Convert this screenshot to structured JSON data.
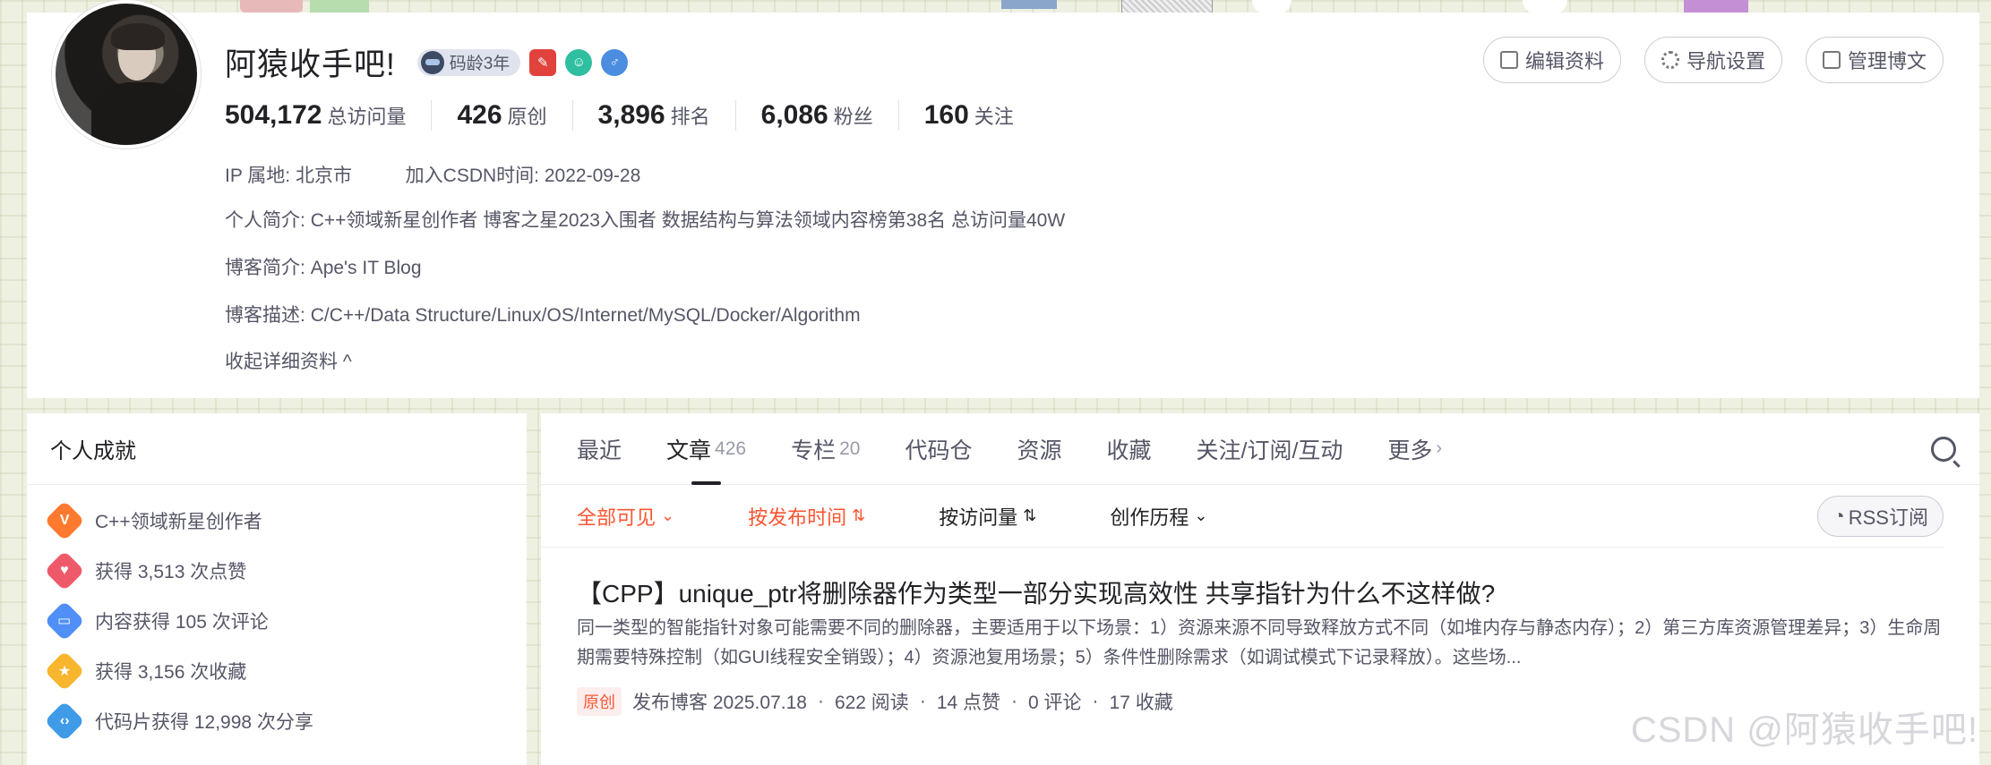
{
  "profile": {
    "username": "阿猿收手吧!",
    "years_badge": "码龄3年",
    "actions": {
      "edit": "编辑资料",
      "nav": "导航设置",
      "manage": "管理博文"
    },
    "stats": [
      {
        "num": "504,172",
        "label": "总访问量"
      },
      {
        "num": "426",
        "label": "原创"
      },
      {
        "num": "3,896",
        "label": "排名"
      },
      {
        "num": "6,086",
        "label": "粉丝"
      },
      {
        "num": "160",
        "label": "关注"
      }
    ],
    "ip_label": "IP 属地:",
    "ip_value": "北京市",
    "join_label": "加入CSDN时间:",
    "join_value": "2022-09-28",
    "intro_label": "个人简介:",
    "intro_value": "C++领域新星创作者 博客之星2023入围者 数据结构与算法领域内容榜第38名 总访问量40W",
    "blog_label": "博客简介:",
    "blog_value": "Ape's IT Blog",
    "desc_label": "博客描述:",
    "desc_value": "C/C++/Data Structure/Linux/OS/Internet/MySQL/Docker/Algorithm",
    "collapse": "收起详细资料"
  },
  "sidebar": {
    "title": "个人成就",
    "items": [
      {
        "text": "C++领域新星创作者",
        "icon": "V"
      },
      {
        "text": "获得 3,513 次点赞"
      },
      {
        "text": "内容获得 105 次评论"
      },
      {
        "text": "获得 3,156 次收藏"
      },
      {
        "text": "代码片获得 12,998 次分享"
      }
    ]
  },
  "tabs": [
    {
      "label": "最近"
    },
    {
      "label": "文章",
      "count": "426"
    },
    {
      "label": "专栏",
      "count": "20"
    },
    {
      "label": "代码仓"
    },
    {
      "label": "资源"
    },
    {
      "label": "收藏"
    },
    {
      "label": "关注/订阅/互动"
    },
    {
      "label": "更多"
    }
  ],
  "filters": {
    "visibility": "全部可见",
    "sort_time": "按发布时间",
    "sort_views": "按访问量",
    "history": "创作历程",
    "rss": "RSS订阅"
  },
  "article": {
    "title": "【CPP】unique_ptr将删除器作为类型一部分实现高效性 共享指针为什么不这样做?",
    "summary": "同一类型的智能指针对象可能需要不同的删除器，主要适用于以下场景：1）资源来源不同导致释放方式不同（如堆内存与静态内存）；2）第三方库资源管理差异；3）生命周期需要特殊控制（如GUI线程安全销毁）；4）资源池复用场景；5）条件性删除需求（如调试模式下记录释放）。这些场...",
    "tag": "原创",
    "date": "发布博客 2025.07.18",
    "reads": "622 阅读",
    "likes": "14 点赞",
    "comments": "0 评论",
    "favorites": "17 收藏"
  },
  "watermark": "CSDN @阿猿收手吧!",
  "colors": {
    "accent": "#fc5531",
    "text": "#222226",
    "muted": "#555666"
  }
}
